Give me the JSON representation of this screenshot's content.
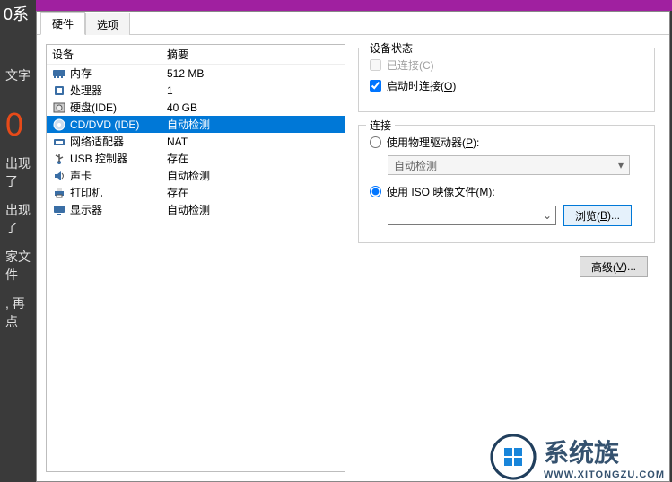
{
  "bg": {
    "topLabel": "0系",
    "textLabel": "文字",
    "zero": "0",
    "l1": "出现了",
    "l2": "出现了",
    "l3": "家文件",
    "l4": ", 再点"
  },
  "tabs": {
    "hardware": "硬件",
    "options": "选项"
  },
  "headers": {
    "device": "设备",
    "summary": "摘要"
  },
  "devices": [
    {
      "id": "memory",
      "name": "内存",
      "summary": "512 MB",
      "icon": "memory"
    },
    {
      "id": "cpu",
      "name": "处理器",
      "summary": "1",
      "icon": "cpu"
    },
    {
      "id": "hdd",
      "name": "硬盘(IDE)",
      "summary": "40 GB",
      "icon": "hdd"
    },
    {
      "id": "cd",
      "name": "CD/DVD (IDE)",
      "summary": "自动检测",
      "icon": "cd",
      "selected": true
    },
    {
      "id": "net",
      "name": "网络适配器",
      "summary": "NAT",
      "icon": "net"
    },
    {
      "id": "usb",
      "name": "USB 控制器",
      "summary": "存在",
      "icon": "usb"
    },
    {
      "id": "sound",
      "name": "声卡",
      "summary": "自动检测",
      "icon": "sound"
    },
    {
      "id": "printer",
      "name": "打印机",
      "summary": "存在",
      "icon": "printer"
    },
    {
      "id": "display",
      "name": "显示器",
      "summary": "自动检测",
      "icon": "display"
    }
  ],
  "right": {
    "status_title": "设备状态",
    "connected_label": "已连接(C)",
    "connect_on_power_label": "启动时连接(O)",
    "connect_on_power_underline": "O",
    "connect_title": "连接",
    "use_physical_label": "使用物理驱动器(P):",
    "use_physical_underline": "P",
    "auto_detect": "自动检测",
    "use_iso_label": "使用 ISO 映像文件(M):",
    "use_iso_underline": "M",
    "browse_label": "浏览(B)...",
    "browse_underline": "B",
    "advanced_label": "高级(V)...",
    "advanced_underline": "V",
    "iso_path": ""
  },
  "watermark": {
    "big": "系统族",
    "small": "WWW.XITONGZU.COM"
  }
}
